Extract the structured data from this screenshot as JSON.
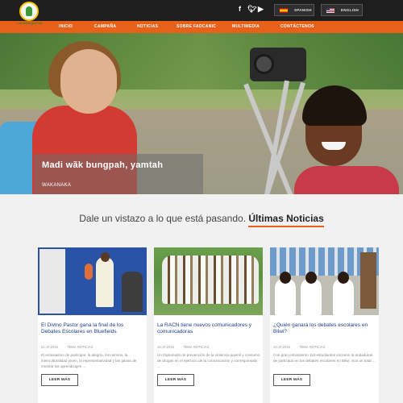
{
  "header": {
    "logo_text": "LA MOSQUITIA",
    "social_icons": [
      "facebook-icon",
      "twitter-icon",
      "youtube-icon"
    ],
    "languages": [
      {
        "label": "SPANISH",
        "flag": "spain-flag-icon"
      },
      {
        "label": "ENGLISH",
        "flag": "us-flag-icon"
      }
    ]
  },
  "nav": {
    "items": [
      "INICIO",
      "CAMPAÑA",
      "NOTICIAS",
      "SOBRE FADCANIC",
      "MULTIMEDIA",
      "CONTÁCTENOS"
    ]
  },
  "hero": {
    "title": "Madi wãk bungpah, yamtah",
    "subtitle": "WAKANAKA"
  },
  "news": {
    "lead": "Dale un vistazo a lo que está pasando.",
    "highlight": "Últimas Noticias"
  },
  "cards": [
    {
      "title": "El Divino Pastor gana la final de los Debates Escolares en Bluefields",
      "date": "21.10.2015",
      "tag": "TEMA NOTICIAS",
      "text": "El entusiasmo de participar, la alegría, los nervios, la interculturalidad joven, la representatividad y las ganas de mostrar los aprendizajes ...",
      "button": "LEER MÁS"
    },
    {
      "title": "La RACN tiene nuevos comunicadores y comunicadoras",
      "date": "15.10.2015",
      "tag": "TEMA NOTICIAS",
      "text": "Un Diplomado de prevención de la violencia juvenil y consumo de drogas en el ejercicio de la comunicación y corresponsabi ...",
      "button": "LEER MÁS"
    },
    {
      "title": "¿Quién ganará los debates escolares en Bilwi?",
      "date": "13.10.2015",
      "tag": "TEMA NOTICIAS",
      "text": "Con gran entusiasmo 110 estudiantes iniciaron la andaduras de participar en los debates escolares en Bilwi. Son un total ...",
      "button": "LEER MÁS"
    }
  ],
  "colors": {
    "accent": "#e8611a",
    "topbar": "#1e1e1e",
    "link": "#1c3f8a"
  }
}
